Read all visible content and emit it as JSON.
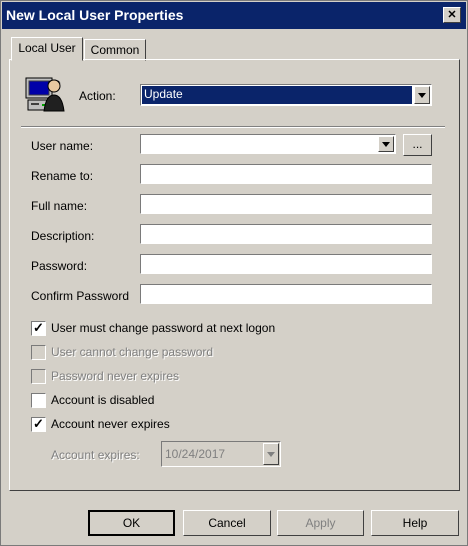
{
  "window": {
    "title": "New Local User Properties",
    "close_glyph": "✕"
  },
  "tabs": [
    {
      "label": "Local User",
      "active": true
    },
    {
      "label": "Common",
      "active": false
    }
  ],
  "action": {
    "label": "Action:",
    "value": "Update",
    "icon": "user-computer-icon"
  },
  "fields": [
    {
      "label": "User name:",
      "value": "",
      "type": "combo"
    },
    {
      "label": "Rename to:",
      "value": ""
    },
    {
      "label": "Full name:",
      "value": ""
    },
    {
      "label": "Description:",
      "value": ""
    },
    {
      "label": "Password:",
      "value": ""
    },
    {
      "label": "Confirm Password",
      "value": ""
    }
  ],
  "browse_label": "...",
  "checkboxes": [
    {
      "label": "User must change password at next logon",
      "checked": true,
      "enabled": true
    },
    {
      "label": "User cannot change password",
      "checked": false,
      "enabled": false
    },
    {
      "label": "Password never expires",
      "checked": false,
      "enabled": false
    },
    {
      "label": "Account is disabled",
      "checked": false,
      "enabled": true
    },
    {
      "label": "Account never expires",
      "checked": true,
      "enabled": true
    }
  ],
  "check_glyph": "✓",
  "expires": {
    "label": "Account expires:",
    "value": "10/24/2017",
    "enabled": false
  },
  "buttons": {
    "ok": "OK",
    "cancel": "Cancel",
    "apply": "Apply",
    "help": "Help"
  },
  "colors": {
    "titlebar": "#0a246a",
    "dialog": "#d4d0c8",
    "selection": "#0a246a"
  }
}
